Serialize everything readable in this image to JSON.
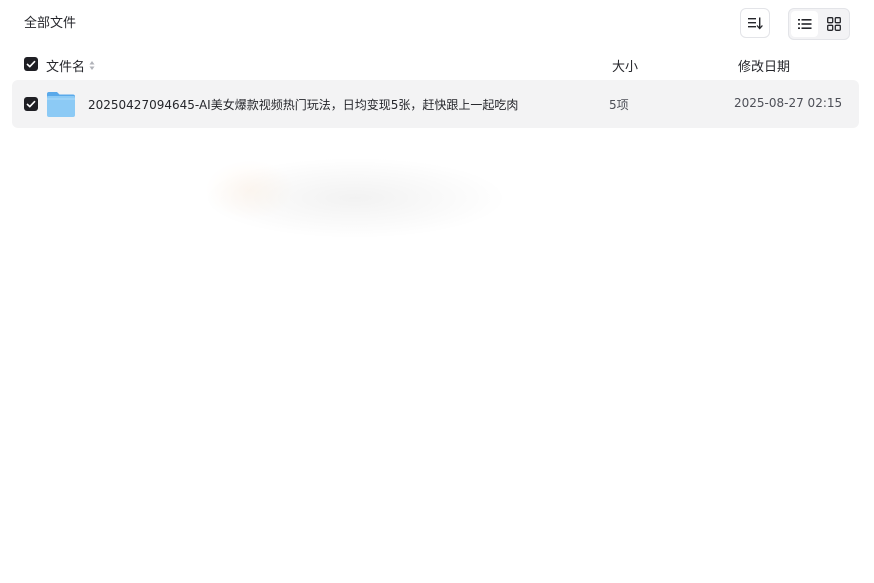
{
  "breadcrumb": {
    "label": "全部文件"
  },
  "toolbar": {
    "sort_icon": "sort-icon",
    "list_view_icon": "list-view-icon",
    "grid_view_icon": "grid-view-icon",
    "active_view": "list"
  },
  "table": {
    "columns": {
      "name": "文件名",
      "size": "大小",
      "date": "修改日期"
    },
    "rows": [
      {
        "selected": true,
        "icon": "folder-icon",
        "name": "20250427094645-AI美女爆款视频热门玩法，日均变现5张，赶快跟上一起吃肉",
        "size": "5项",
        "date": "2025-08-27 02:15"
      }
    ]
  },
  "colors": {
    "checkbox": "#1f1f24",
    "row_highlight": "#f3f3f4",
    "folder": "#7cc0f2"
  }
}
